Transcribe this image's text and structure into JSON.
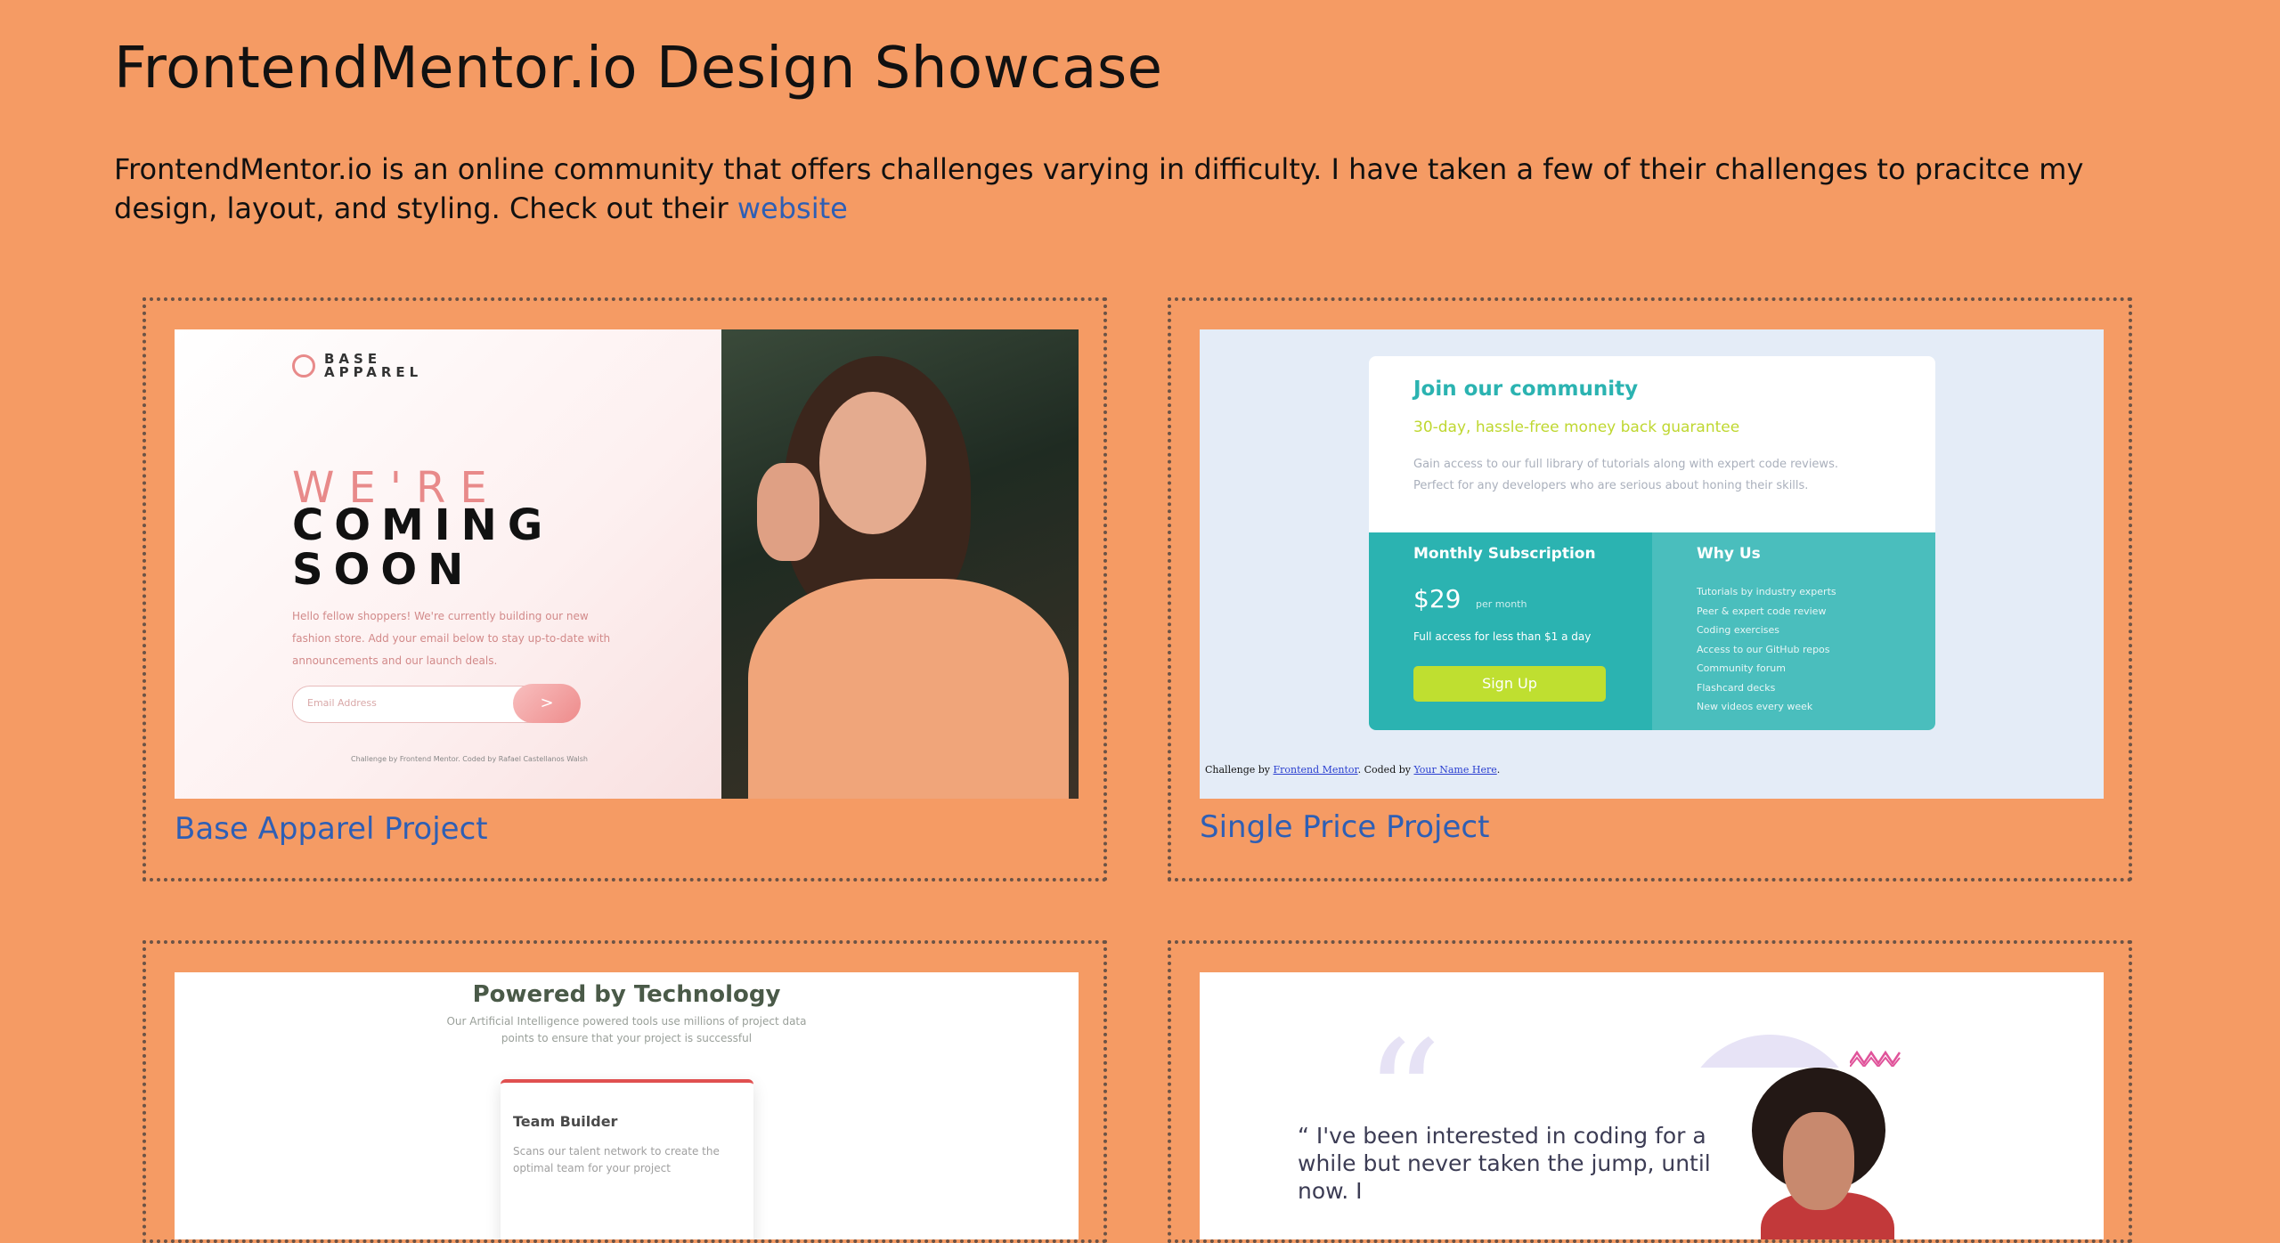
{
  "page": {
    "title": "FrontendMentor.io Design Showcase",
    "intro_text": "FrontendMentor.io is an online community that offers challenges varying in difficulty. I have taken a few of their challenges to pracitce my design, layout, and styling. Check out their ",
    "intro_link": "website"
  },
  "colors": {
    "background": "#f59b64",
    "link": "#2e5fb5"
  },
  "projects": [
    {
      "link_label": "Base Apparel Project",
      "preview": {
        "logo": "BASE\nAPPAREL",
        "heading_light": "WE'RE",
        "heading_bold": "COMING\nSOON",
        "description": "Hello fellow shoppers! We're currently building our new fashion store. Add your email below to stay up-to-date with announcements and our launch deals.",
        "email_placeholder": "Email Address",
        "submit_glyph": ">",
        "footer": "Challenge by Frontend Mentor. Coded by Rafael Castellanos Walsh"
      }
    },
    {
      "link_label": "Single Price Project",
      "preview": {
        "heading": "Join our community",
        "subheading": "30-day, hassle-free money back guarantee",
        "paragraph": "Gain access to our full library of tutorials along with expert code reviews. Perfect for any developers who are serious about honing their skills.",
        "plan_title": "Monthly Subscription",
        "price": "$29",
        "price_period": "per month",
        "price_note": "Full access for less than $1 a day",
        "cta": "Sign Up",
        "why_title": "Why Us",
        "why_items": [
          "Tutorials by industry experts",
          "Peer & expert code review",
          "Coding exercises",
          "Access to our GitHub repos",
          "Community forum",
          "Flashcard decks",
          "New videos every week"
        ],
        "footer_prefix": "Challenge by ",
        "footer_link1": "Frontend Mentor",
        "footer_mid": ". Coded by ",
        "footer_link2": "Your Name Here",
        "footer_suffix": "."
      }
    },
    {
      "preview": {
        "heading": "Powered by Technology",
        "paragraph": "Our Artificial Intelligence powered tools use millions of project data points to ensure that your project is successful",
        "card_title": "Team Builder",
        "card_text": "Scans our talent network to create the optimal team for your project"
      }
    },
    {
      "preview": {
        "quote": "“ I've been interested in coding for a while but never taken the jump, until now. I"
      }
    }
  ]
}
